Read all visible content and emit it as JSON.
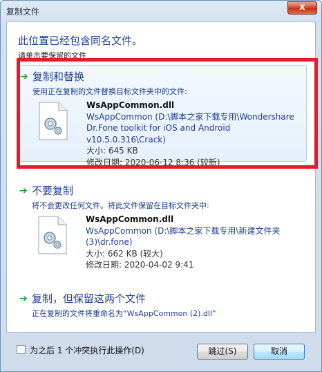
{
  "window": {
    "title": "复制文件",
    "close_label": "x"
  },
  "header": {
    "title": "此位置已经包含同名文件。",
    "subtitle": "请单击要保留的文件"
  },
  "options": {
    "replace": {
      "arrow": "➔",
      "title": "复制和替换",
      "description": "使用正在复制的文件替换目标文件夹中的文件:",
      "file": {
        "name": "WsAppCommon.dll",
        "path_line1": "WsAppCommon (D:\\脚本之家下载专用\\Wondershare",
        "path_line2": "Dr.Fone toolkit for iOS and Android v10.5.0.316\\Crack)",
        "size": "大小: 645 KB",
        "modified": "修改日期: 2020-06-12 8:36 (较新)"
      }
    },
    "skip": {
      "arrow": "➔",
      "title": "不要复制",
      "description": "将不会更改任何文件。将此文件保留在目标文件夹中:",
      "file": {
        "name": "WsAppCommon.dll",
        "path_line1": "WsAppCommon (D:\\脚本之家下载专用\\新建文件夹",
        "path_line2": "(3)\\dr.fone)",
        "size": "大小: 662 KB (较大)",
        "modified": "修改日期: 2020-04-02 9:41"
      }
    },
    "keep_both": {
      "arrow": "➔",
      "title": "复制，但保留这两个文件",
      "description": "正在复制的文件将重命名为“WsAppCommon (2).dll”"
    }
  },
  "footer": {
    "checkbox_label": "为之后 1 个冲突执行此操作(D)",
    "skip_button": "跳过(S)",
    "cancel_button": "取消"
  },
  "colors": {
    "highlight": "#e51b2b",
    "link_blue": "#1c3d8f",
    "arrow_green": "#2b9a2b"
  }
}
